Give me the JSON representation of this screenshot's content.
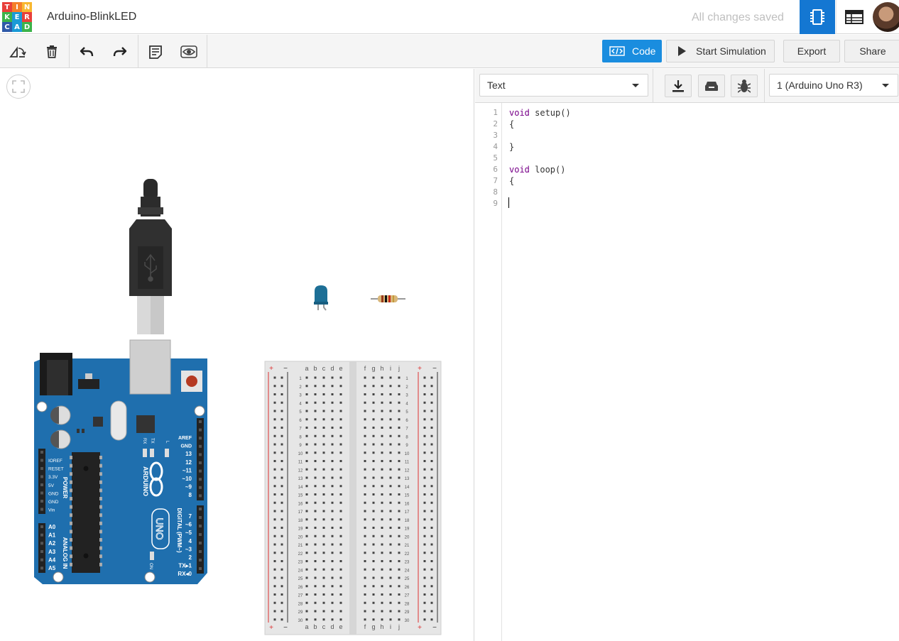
{
  "app": {
    "logo_letters": [
      "T",
      "I",
      "N",
      "K",
      "E",
      "R",
      "C",
      "A",
      "D"
    ],
    "logo_colors": [
      "#e8403b",
      "#f57f2a",
      "#f8b72f",
      "#3cb34a",
      "#1a9ad6",
      "#e8403b",
      "#2f5aa8",
      "#1a9ad6",
      "#3cb34a"
    ],
    "project_title": "Arduino-BlinkLED",
    "save_status": "All changes saved",
    "accent": "#1477d2"
  },
  "toolbar": {
    "code_label": "Code",
    "simulation_label": "Start Simulation",
    "export_label": "Export",
    "share_label": "Share",
    "tools": [
      "rotate-icon",
      "trash-icon",
      "undo-icon",
      "redo-icon",
      "notes-icon",
      "eye-icon"
    ]
  },
  "code_panel": {
    "mode_selected": "Text",
    "device_selected": "1 (Arduino Uno R3)",
    "line_numbers": [
      "1",
      "2",
      "3",
      "4",
      "5",
      "6",
      "7",
      "8",
      "9"
    ],
    "lines": [
      {
        "kw": "void",
        "rest": " setup()"
      },
      {
        "kw": "",
        "rest": "{"
      },
      {
        "kw": "",
        "rest": ""
      },
      {
        "kw": "",
        "rest": "}"
      },
      {
        "kw": "",
        "rest": ""
      },
      {
        "kw": "void",
        "rest": " loop()"
      },
      {
        "kw": "",
        "rest": "{"
      },
      {
        "kw": "",
        "rest": ""
      },
      {
        "kw": "",
        "rest": ""
      }
    ]
  },
  "board": {
    "name": "ARDUINO",
    "model": "UNO",
    "power_pins": [
      "IOREF",
      "RESET",
      "3.3V",
      "5V",
      "GND",
      "GND",
      "Vin"
    ],
    "analog_pins": [
      "A0",
      "A1",
      "A2",
      "A3",
      "A4",
      "A5"
    ],
    "power_label": "POWER",
    "analog_label": "ANALOG IN",
    "digital_pins_top": [
      "AREF",
      "GND",
      "13",
      "12",
      "~11",
      "~10",
      "~9",
      "8"
    ],
    "digital_pins_bottom": [
      "7",
      "~6",
      "~5",
      "4",
      "~3",
      "2",
      "TX▸1",
      "RX◂0"
    ],
    "digital_label": "DIGITAL (PWM~)",
    "tx_label": "TX",
    "rx_label": "RX",
    "l_label": "L",
    "on_label": "ON"
  },
  "breadboard": {
    "left_columns": [
      "a",
      "b",
      "c",
      "d",
      "e"
    ],
    "right_columns": [
      "f",
      "g",
      "h",
      "i",
      "j"
    ],
    "plus": "+",
    "minus": "−",
    "rows": [
      "1",
      "2",
      "3",
      "4",
      "5",
      "6",
      "7",
      "8",
      "9",
      "10",
      "11",
      "12",
      "13",
      "14",
      "15",
      "16",
      "17",
      "18",
      "19",
      "20",
      "21",
      "22",
      "23",
      "24",
      "25",
      "26",
      "27",
      "28",
      "29",
      "30"
    ]
  }
}
